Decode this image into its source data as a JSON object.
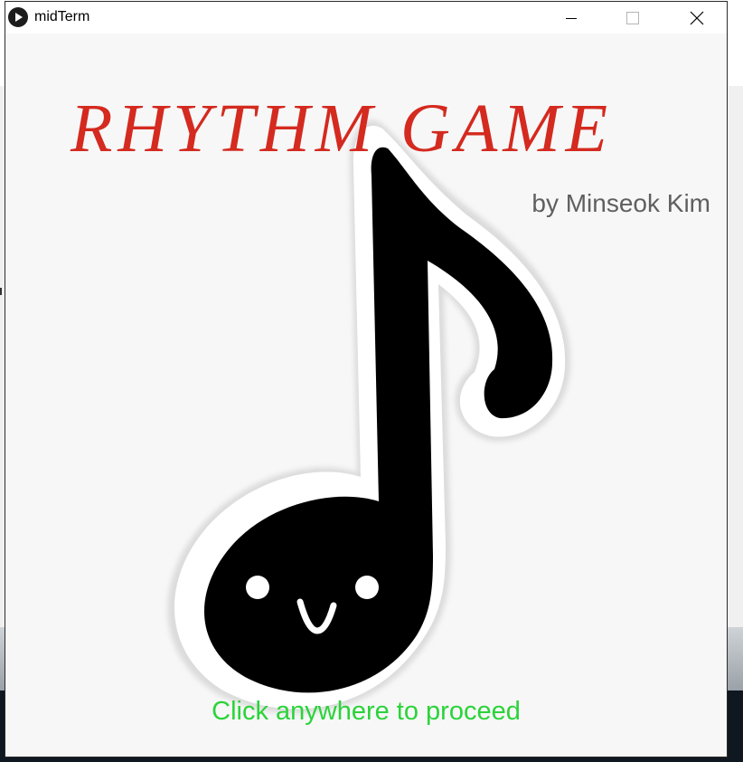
{
  "window": {
    "title": "midTerm",
    "icon": "play-icon"
  },
  "titlebar_controls": {
    "minimize_icon": "minimize-icon",
    "maximize_icon": "maximize-icon",
    "close_icon": "close-icon"
  },
  "screen": {
    "title": "RHYTHM GAME",
    "byline": "by Minseok Kim",
    "prompt": "Click anywhere to proceed",
    "illustration": "music-note-mascot-icon"
  },
  "colors": {
    "title": "#d42a1f",
    "byline": "#5f5f5f",
    "prompt": "#2bd33a",
    "note": "#000000"
  }
}
